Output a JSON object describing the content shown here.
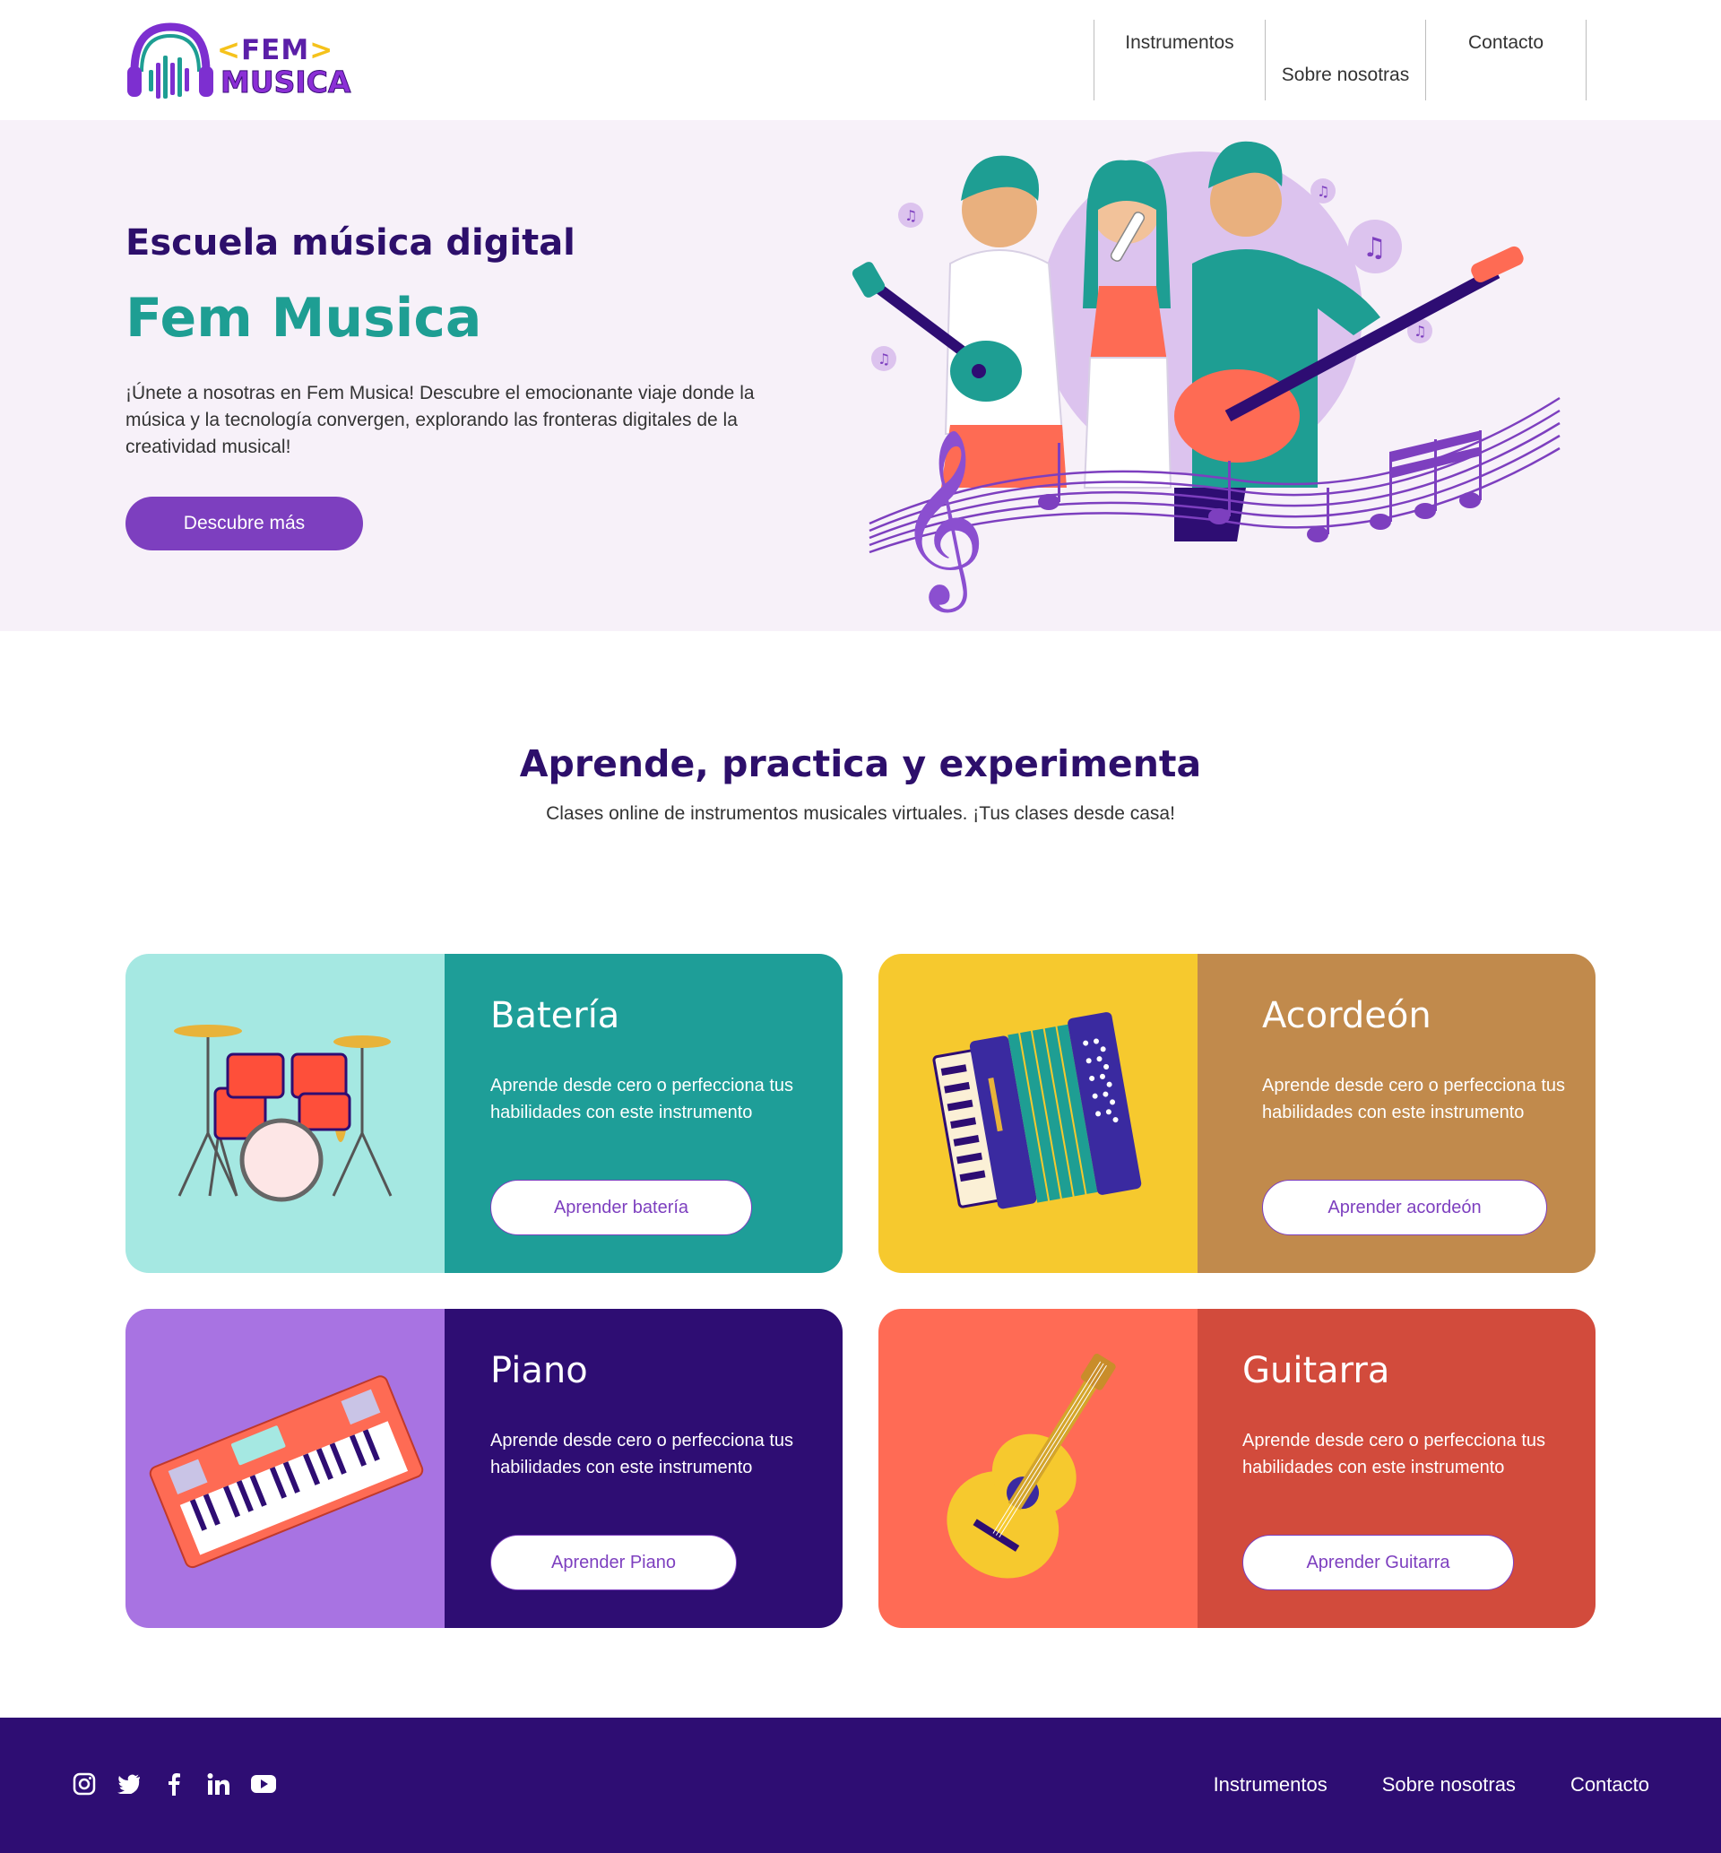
{
  "header": {
    "logo": {
      "word_top": "FEM",
      "word_bottom": "MUSICA",
      "bracket_left": "<",
      "bracket_right": ">"
    },
    "nav": [
      {
        "label": "Instrumentos"
      },
      {
        "label": "Sobre nosotras"
      },
      {
        "label": "Contacto"
      }
    ]
  },
  "hero": {
    "subtitle": "Escuela música digital",
    "title": "Fem Musica",
    "text": "¡Únete a nosotras en Fem Musica! Descubre el emocionante viaje donde la música y la tecnología convergen, explorando las fronteras digitales de la creatividad musical!",
    "button": "Descubre más",
    "illustration": "band-illustration"
  },
  "section": {
    "title": "Aprende, practica y experimenta",
    "subtitle": "Clases online de instrumentos musicales virtuales. ¡Tus clases desde casa!"
  },
  "cards": [
    {
      "title": "Batería",
      "text": "Aprende desde cero o perfecciona tus habilidades con este instrumento",
      "button": "Aprender batería",
      "icon": "drums-icon",
      "color_img": "#a5e8e2",
      "color_body": "#1e9e98"
    },
    {
      "title": "Acordeón",
      "text": "Aprende desde cero o perfecciona tus habilidades con este instrumento",
      "button": "Aprender acordeón",
      "icon": "accordion-icon",
      "color_img": "#f6c92e",
      "color_body": "#c18a4c"
    },
    {
      "title": "Piano",
      "text": "Aprende desde cero o perfecciona tus habilidades con este instrumento",
      "button": "Aprender Piano",
      "icon": "keyboard-icon",
      "color_img": "#a873e2",
      "color_body": "#2e0d73"
    },
    {
      "title": "Guitarra",
      "text": "Aprende desde cero o perfecciona tus habilidades con este instrumento",
      "button": "Aprender Guitarra",
      "icon": "guitar-icon",
      "color_img": "#ff6b55",
      "color_body": "#d24b3c"
    }
  ],
  "footer": {
    "social": [
      "instagram-icon",
      "twitter-icon",
      "facebook-icon",
      "linkedin-icon",
      "youtube-icon"
    ],
    "nav": [
      {
        "label": "Instrumentos"
      },
      {
        "label": "Sobre nosotras"
      },
      {
        "label": "Contacto"
      }
    ]
  },
  "colors": {
    "primary_purple": "#7d3fbf",
    "dark_purple": "#2e0d73",
    "teal": "#1e9e93",
    "hero_bg": "#f7f1f9"
  }
}
